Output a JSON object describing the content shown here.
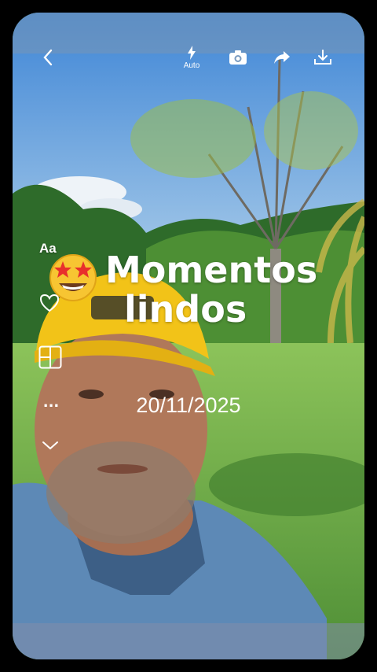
{
  "toolbar": {
    "back_icon": "chevron-left-icon",
    "flash_icon": "flash-icon",
    "flash_label": "Auto",
    "camera_icon": "camera-icon",
    "share_icon": "share-icon",
    "download_icon": "download-icon"
  },
  "side_tools": {
    "text_label": "Aa",
    "heart_icon": "heart-icon",
    "layout_icon": "layout-grid-icon",
    "more_label": "...",
    "collapse_icon": "chevron-down-icon"
  },
  "story": {
    "caption_line1": "Momentos",
    "caption_line2": "lindos",
    "emoji": "star-struck-emoji",
    "date": "20/11/2025"
  },
  "colors": {
    "sky": "#5f9ee0",
    "grass": "#6fb04a",
    "trees": "#2f6a2a",
    "cap": "#f2c318",
    "shirt": "#5d89b6",
    "skin": "#b0785a"
  }
}
